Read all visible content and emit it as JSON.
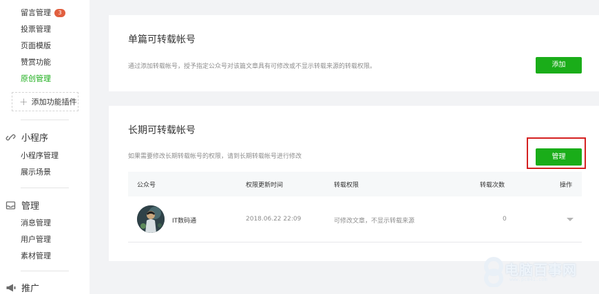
{
  "sidebar": {
    "items_top": [
      {
        "label": "留言管理",
        "badge": "3"
      },
      {
        "label": "投票管理"
      },
      {
        "label": "页面模版"
      },
      {
        "label": "赞赏功能"
      },
      {
        "label": "原创管理",
        "active": true
      }
    ],
    "add_plugin_label": "添加功能插件",
    "sections": [
      {
        "title": "小程序",
        "icon": "link-icon",
        "items": [
          "小程序管理",
          "展示场景"
        ]
      },
      {
        "title": "管理",
        "icon": "inbox-icon",
        "items": [
          "消息管理",
          "用户管理",
          "素材管理"
        ]
      },
      {
        "title": "推广",
        "icon": "megaphone-icon",
        "items": []
      }
    ]
  },
  "card_single": {
    "title": "单篇可转载帐号",
    "desc": "通过添加转载帐号，授予指定公众号对该篇文章具有可修改或不显示转载来源的转载权限。",
    "add_button": "添加"
  },
  "card_long": {
    "title": "长期可转载帐号",
    "desc": "如果需要修改长期转载帐号的权限，请到长期转载帐号进行修改",
    "manage_button": "管理",
    "columns": [
      "公众号",
      "权限更新时间",
      "转载权限",
      "转载次数",
      "操作"
    ],
    "rows": [
      {
        "account": "IT数码通",
        "updated": "2018.06.22 22:09",
        "permission": "可修改文章，不显示转载来源",
        "count": "0"
      }
    ]
  },
  "watermark": {
    "text": "电脑百事网",
    "url": "www.pc841.com"
  },
  "colors": {
    "accent": "#1aad19",
    "badge": "#e15f3f",
    "highlight": "#d42020",
    "background": "#f2f3f5"
  }
}
